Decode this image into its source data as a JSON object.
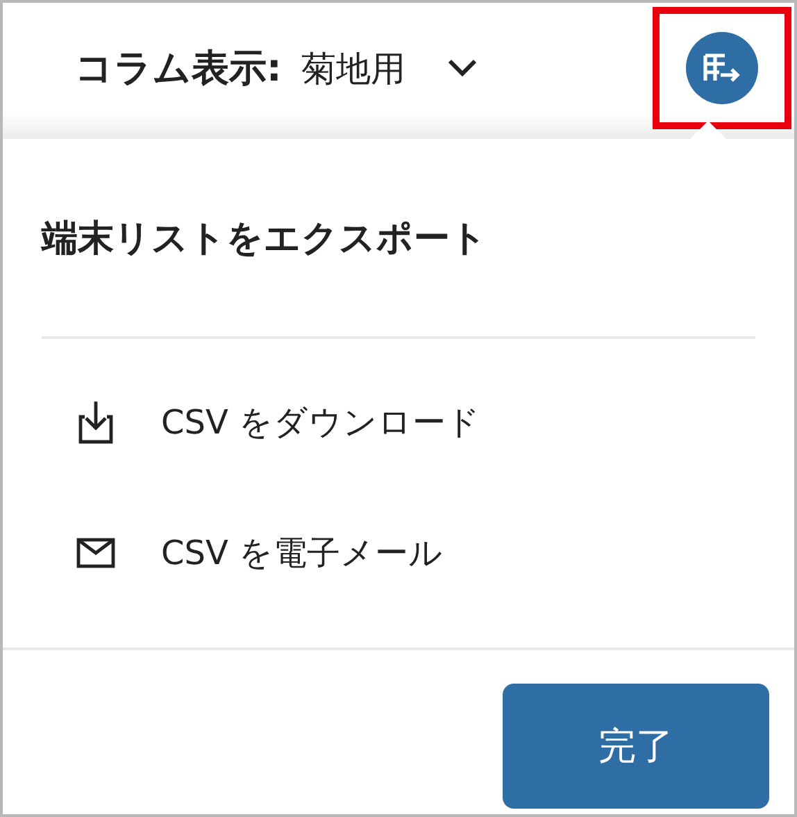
{
  "toolbar": {
    "label": "コラム表示:",
    "column_view": "菊地用",
    "export_button": {
      "highlighted": true
    }
  },
  "menu": {
    "title": "端末リストをエクスポート",
    "items": [
      {
        "kind": "download",
        "label": "CSV をダウンロード"
      },
      {
        "kind": "email",
        "label": "CSV を電子メール"
      }
    ]
  },
  "buttons": [
    "完了"
  ]
}
